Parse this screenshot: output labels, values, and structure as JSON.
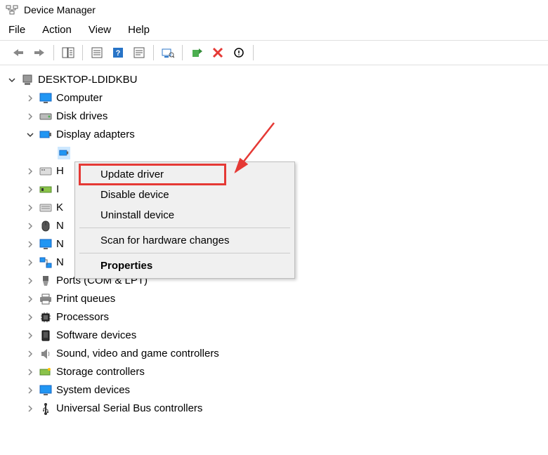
{
  "window": {
    "title": "Device Manager"
  },
  "menu": {
    "file": "File",
    "action": "Action",
    "view": "View",
    "help": "Help"
  },
  "tree": {
    "root": "DESKTOP-LDIDKBU",
    "items": [
      {
        "label": "Computer"
      },
      {
        "label": "Disk drives"
      },
      {
        "label": "Display adapters"
      },
      {
        "label": "H"
      },
      {
        "label": "I"
      },
      {
        "label": "K"
      },
      {
        "label": "N"
      },
      {
        "label": "N"
      },
      {
        "label": "N"
      },
      {
        "label": "Ports (COM & LPT)"
      },
      {
        "label": "Print queues"
      },
      {
        "label": "Processors"
      },
      {
        "label": "Software devices"
      },
      {
        "label": "Sound, video and game controllers"
      },
      {
        "label": "Storage controllers"
      },
      {
        "label": "System devices"
      },
      {
        "label": "Universal Serial Bus controllers"
      }
    ]
  },
  "context_menu": {
    "update": "Update driver",
    "disable": "Disable device",
    "uninstall": "Uninstall device",
    "scan": "Scan for hardware changes",
    "properties": "Properties"
  }
}
